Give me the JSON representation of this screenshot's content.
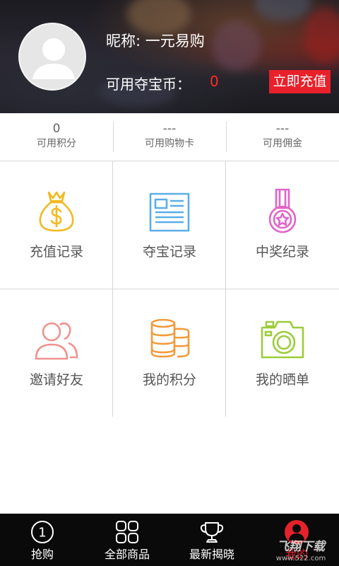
{
  "header": {
    "nickname": "昵称: 一元易购",
    "coins_label": "可用夺宝币：",
    "coins_value": "0",
    "recharge_label": "立即充值"
  },
  "stats": [
    {
      "value": "0",
      "label": "可用积分"
    },
    {
      "value": "---",
      "label": "可用购物卡"
    },
    {
      "value": "---",
      "label": "可用佣金"
    }
  ],
  "menu": [
    {
      "label": "充值记录",
      "icon": "money-bag-icon",
      "color": "#f3b923"
    },
    {
      "label": "夺宝记录",
      "icon": "document-icon",
      "color": "#5aaee8"
    },
    {
      "label": "中奖纪录",
      "icon": "medal-icon",
      "color": "#e064c8"
    },
    {
      "label": "邀请好友",
      "icon": "users-icon",
      "color": "#f0928e"
    },
    {
      "label": "我的积分",
      "icon": "coin-stack-icon",
      "color": "#f29a3a"
    },
    {
      "label": "我的晒单",
      "icon": "camera-icon",
      "color": "#9ccc3c"
    }
  ],
  "tabbar": [
    {
      "label": "抢购",
      "icon": "circle-one-icon"
    },
    {
      "label": "全部商品",
      "icon": "grid-icon"
    },
    {
      "label": "最新揭晓",
      "icon": "trophy-icon"
    },
    {
      "label": "我的",
      "icon": "user-profile-icon",
      "active": true
    }
  ],
  "colors": {
    "accent": "#e5222b",
    "nav_bg": "#0a0a0a"
  },
  "watermark": {
    "line1": "飞翔下载",
    "line2": "www.522.com"
  }
}
